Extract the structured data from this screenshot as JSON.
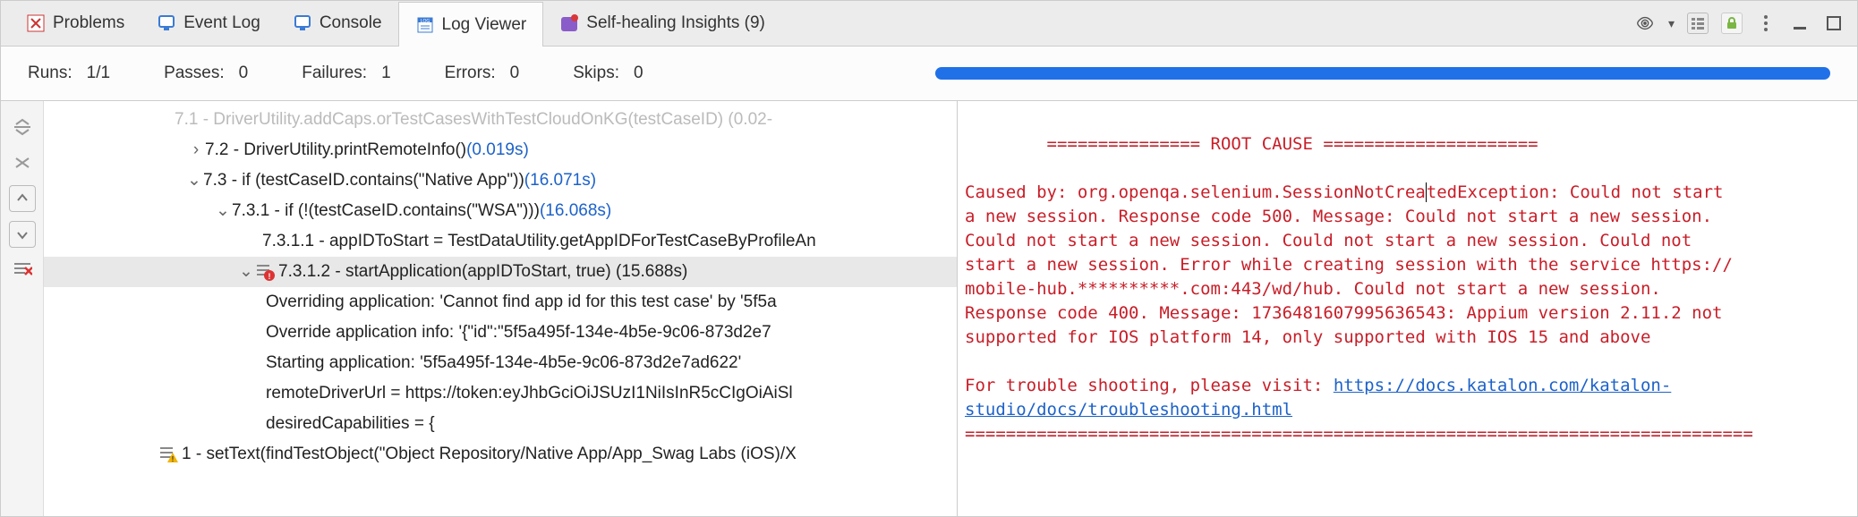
{
  "tabs": [
    {
      "id": "problems",
      "label": "Problems"
    },
    {
      "id": "eventlog",
      "label": "Event Log"
    },
    {
      "id": "console",
      "label": "Console"
    },
    {
      "id": "logviewer",
      "label": "Log Viewer"
    },
    {
      "id": "selfheal",
      "label": "Self-healing Insights (9)"
    }
  ],
  "stats": {
    "runs_label": "Runs:",
    "runs_value": "1/1",
    "passes_label": "Passes:",
    "passes_value": "0",
    "failures_label": "Failures:",
    "failures_value": "1",
    "errors_label": "Errors:",
    "errors_value": "0",
    "skips_label": "Skips:",
    "skips_value": "0"
  },
  "tree": {
    "row_cut": "7.1 - DriverUtility.addCaps.orTestCasesWithTestCloudOnKG(testCaseID) (0.02-",
    "row_72": "7.2 - DriverUtility.printRemoteInfo() ",
    "row_72_time": "(0.019s)",
    "row_73": "7.3 - if (testCaseID.contains(\"Native App\")) ",
    "row_73_time": "(16.071s)",
    "row_731": "7.3.1 - if (!(testCaseID.contains(\"WSA\"))) ",
    "row_731_time": "(16.068s)",
    "row_7311": "7.3.1.1 - appIDToStart = TestDataUtility.getAppIDForTestCaseByProfileAn",
    "row_7312": "7.3.1.2 - startApplication(appIDToStart, true) (15.688s)",
    "detail1": "Overriding application: 'Cannot find app id for this test case' by '5f5a",
    "detail2": "Override application info: '{\"id\":\"5f5a495f-134e-4b5e-9c06-873d2e7",
    "detail3": "Starting application: '5f5a495f-134e-4b5e-9c06-873d2e7ad622'",
    "detail4": "remoteDriverUrl = https://token:eyJhbGciOiJSUzI1NiIsInR5cCIgOiAiSl",
    "detail5": "desiredCapabilities = {",
    "row_1": "1 - setText(findTestObject(\"Object Repository/Native App/App_Swag Labs (iOS)/X"
  },
  "rootcause": {
    "header_left": "=============== ",
    "header_title": "ROOT CAUSE",
    "header_right": " =====================",
    "line1a": "Caused by: org.openqa.selenium.SessionNotCrea",
    "line1b": "tedException: Could not start",
    "line2": "a new session. Response code 500. Message: Could not start a new session.",
    "line3": "Could not start a new session. Could not start a new session. Could not",
    "line4": "start a new session. Error while creating session with the service https://",
    "line5": "mobile-hub.**********.com:443/wd/hub. Could not start a new session.",
    "line6": "Response code 400. Message: 1736481607995636543: Appium version 2.11.2 not",
    "line7": "supported for IOS platform 14, only supported with IOS 15 and above",
    "ts_prefix": "For trouble shooting, please visit: ",
    "ts_link1": "https://docs.katalon.com/katalon-",
    "ts_link2": "studio/docs/troubleshooting.html",
    "footer": "============================================================================="
  }
}
